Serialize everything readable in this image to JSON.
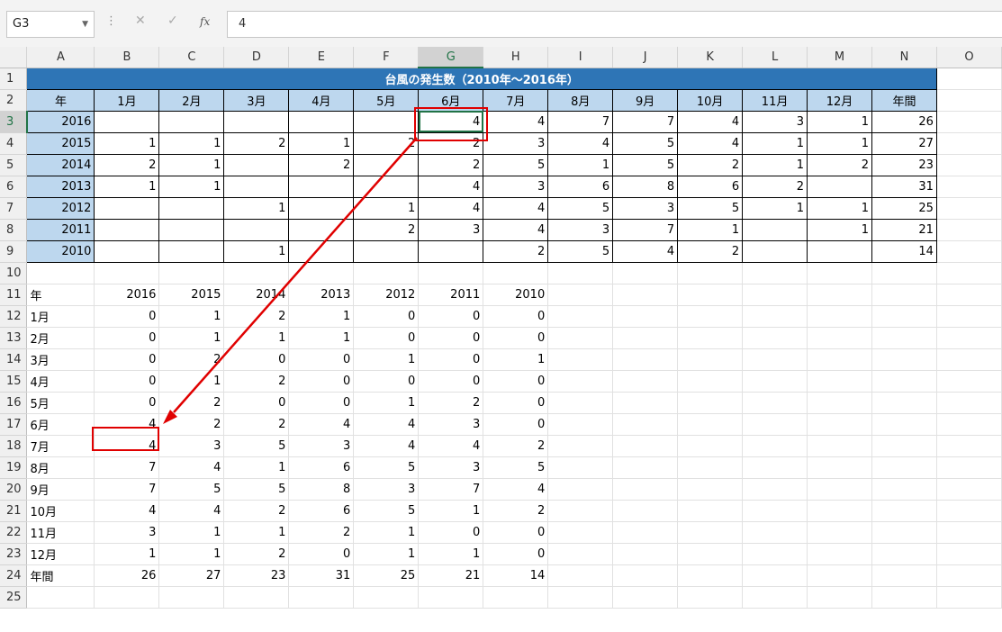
{
  "formula_bar": {
    "name_box": "G3",
    "value": "4"
  },
  "columns": [
    "A",
    "B",
    "C",
    "D",
    "E",
    "F",
    "G",
    "H",
    "I",
    "J",
    "K",
    "L",
    "M",
    "N",
    "O"
  ],
  "row_numbers": [
    "1",
    "2",
    "3",
    "4",
    "5",
    "6",
    "7",
    "8",
    "9",
    "10",
    "11",
    "12",
    "13",
    "14",
    "15",
    "16",
    "17",
    "18",
    "19",
    "20",
    "21",
    "22",
    "23",
    "24",
    "25"
  ],
  "source_table": {
    "title": "台風の発生数（2010年～2016年）",
    "headers": [
      "年",
      "1月",
      "2月",
      "3月",
      "4月",
      "5月",
      "6月",
      "7月",
      "8月",
      "9月",
      "10月",
      "11月",
      "12月",
      "年間"
    ],
    "rows": [
      [
        "2016",
        "",
        "",
        "",
        "",
        "",
        "4",
        "4",
        "7",
        "7",
        "4",
        "3",
        "1",
        "26"
      ],
      [
        "2015",
        "1",
        "1",
        "2",
        "1",
        "2",
        "2",
        "3",
        "4",
        "5",
        "4",
        "1",
        "1",
        "27"
      ],
      [
        "2014",
        "2",
        "1",
        "",
        "2",
        "",
        "2",
        "5",
        "1",
        "5",
        "2",
        "1",
        "2",
        "23"
      ],
      [
        "2013",
        "1",
        "1",
        "",
        "",
        "",
        "4",
        "3",
        "6",
        "8",
        "6",
        "2",
        "",
        "31"
      ],
      [
        "2012",
        "",
        "",
        "1",
        "",
        "1",
        "4",
        "4",
        "5",
        "3",
        "5",
        "1",
        "1",
        "25"
      ],
      [
        "2011",
        "",
        "",
        "",
        "",
        "2",
        "3",
        "4",
        "3",
        "7",
        "1",
        "",
        "1",
        "21"
      ],
      [
        "2010",
        "",
        "",
        "1",
        "",
        "",
        "",
        "2",
        "5",
        "4",
        "2",
        "",
        "",
        "14"
      ]
    ]
  },
  "transposed_table": {
    "header": [
      "年",
      "2016",
      "2015",
      "2014",
      "2013",
      "2012",
      "2011",
      "2010"
    ],
    "rows": [
      [
        "1月",
        "0",
        "1",
        "2",
        "1",
        "0",
        "0",
        "0"
      ],
      [
        "2月",
        "0",
        "1",
        "1",
        "1",
        "0",
        "0",
        "0"
      ],
      [
        "3月",
        "0",
        "2",
        "0",
        "0",
        "1",
        "0",
        "1"
      ],
      [
        "4月",
        "0",
        "1",
        "2",
        "0",
        "0",
        "0",
        "0"
      ],
      [
        "5月",
        "0",
        "2",
        "0",
        "0",
        "1",
        "2",
        "0"
      ],
      [
        "6月",
        "4",
        "2",
        "2",
        "4",
        "4",
        "3",
        "0"
      ],
      [
        "7月",
        "4",
        "3",
        "5",
        "3",
        "4",
        "4",
        "2"
      ],
      [
        "8月",
        "7",
        "4",
        "1",
        "6",
        "5",
        "3",
        "5"
      ],
      [
        "9月",
        "7",
        "5",
        "5",
        "8",
        "3",
        "7",
        "4"
      ],
      [
        "10月",
        "4",
        "4",
        "2",
        "6",
        "5",
        "1",
        "2"
      ],
      [
        "11月",
        "3",
        "1",
        "1",
        "2",
        "1",
        "0",
        "0"
      ],
      [
        "12月",
        "1",
        "1",
        "2",
        "0",
        "1",
        "1",
        "0"
      ],
      [
        "年間",
        "26",
        "27",
        "23",
        "31",
        "25",
        "21",
        "14"
      ]
    ]
  },
  "selection": {
    "cell": "G3",
    "column": "G",
    "row": "3",
    "accent": "#217346"
  },
  "colors": {
    "title_bg": "#2e75b6",
    "header_bg": "#bdd7ee",
    "annotation": "#e00000"
  }
}
